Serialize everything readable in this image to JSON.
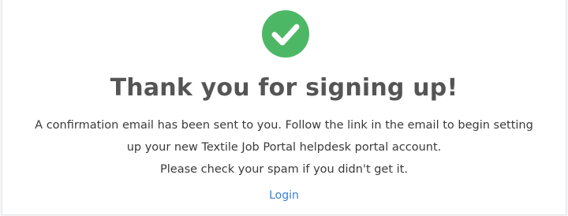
{
  "success_icon": {
    "icon": "check-circle-icon",
    "color": "#4cb865"
  },
  "heading": "Thank you for signing up!",
  "message": {
    "line1": "A confirmation email has been sent to you. Follow the link in the email to begin setting",
    "line2": "up your new Textile Job Portal helpdesk portal account.",
    "line3": "Please check your spam if you didn't get it."
  },
  "login_link": {
    "label": "Login",
    "color": "#3a7fd5"
  }
}
